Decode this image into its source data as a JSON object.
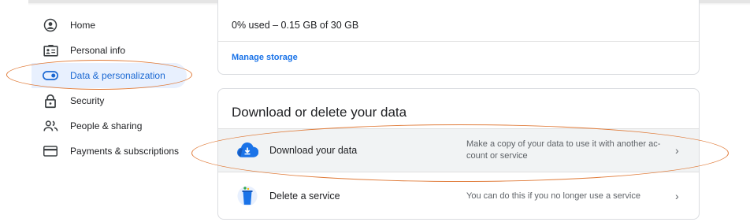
{
  "sidebar": {
    "items": [
      {
        "label": "Home",
        "icon": "account-circle-icon",
        "active": false
      },
      {
        "label": "Personal info",
        "icon": "id-card-icon",
        "active": false
      },
      {
        "label": "Data & personalization",
        "icon": "toggle-icon",
        "active": true
      },
      {
        "label": "Security",
        "icon": "lock-icon",
        "active": false
      },
      {
        "label": "People & sharing",
        "icon": "people-icon",
        "active": false
      },
      {
        "label": "Payments & subscriptions",
        "icon": "credit-card-icon",
        "active": false
      }
    ]
  },
  "storage": {
    "used_text": "0% used – 0.15 GB of 30 GB",
    "manage_link": "Manage storage"
  },
  "download_card": {
    "title": "Download or delete your data",
    "rows": [
      {
        "label": "Download your data",
        "description": "Make a copy of your data to use it with another ac-count or service",
        "icon": "cloud-download-icon",
        "chevron": "›"
      },
      {
        "label": "Delete a service",
        "description": "You can do this if you no longer use a service",
        "icon": "trash-bin-icon",
        "chevron": "›"
      }
    ]
  },
  "colors": {
    "accent": "#1a73e8",
    "active_bg": "#e8f0fe",
    "annotation": "#e07b39"
  }
}
